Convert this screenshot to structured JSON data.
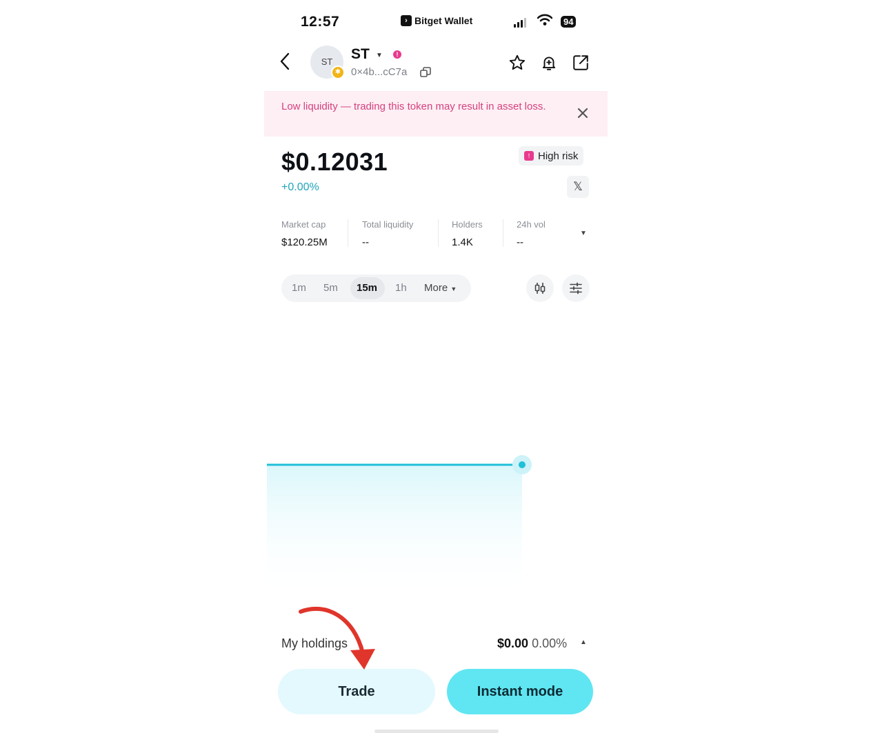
{
  "status_bar": {
    "time": "12:57",
    "app_name": "Bitget Wallet",
    "battery": "94"
  },
  "token": {
    "avatar_text": "ST",
    "symbol": "ST",
    "address": "0×4b...cC7a"
  },
  "banner": {
    "text": "Low liquidity — trading this token may result in asset loss."
  },
  "price": {
    "value": "$0.12031",
    "change": "+0.00%",
    "risk_label": "High risk",
    "social": "𝕏"
  },
  "stats": [
    {
      "label": "Market cap",
      "value": "$120.25M"
    },
    {
      "label": "Total liquidity",
      "value": "--"
    },
    {
      "label": "Holders",
      "value": "1.4K"
    },
    {
      "label": "24h vol",
      "value": "--"
    }
  ],
  "intervals": {
    "options": [
      "1m",
      "5m",
      "15m",
      "1h",
      "More"
    ],
    "selected": "15m"
  },
  "chart_data": {
    "type": "line",
    "series": [
      {
        "values": [
          0.12031,
          0.12031
        ]
      }
    ],
    "flat": true
  },
  "holdings": {
    "label": "My holdings",
    "value": "$0.00",
    "percent": "0.00%"
  },
  "actions": {
    "trade": "Trade",
    "instant": "Instant mode"
  },
  "colors": {
    "accent": "#5fe6f2",
    "line": "#1fc0d8",
    "risk": "#e83a8f",
    "banner_text": "#d6407e",
    "banner_bg": "#fdeff4",
    "annotation_arrow": "#e0352b"
  },
  "icons": [
    "back-arrow-icon",
    "copy-icon",
    "star-icon",
    "bell-plus-icon",
    "share-icon",
    "close-icon",
    "candlestick-icon",
    "settings-sliders-icon"
  ]
}
